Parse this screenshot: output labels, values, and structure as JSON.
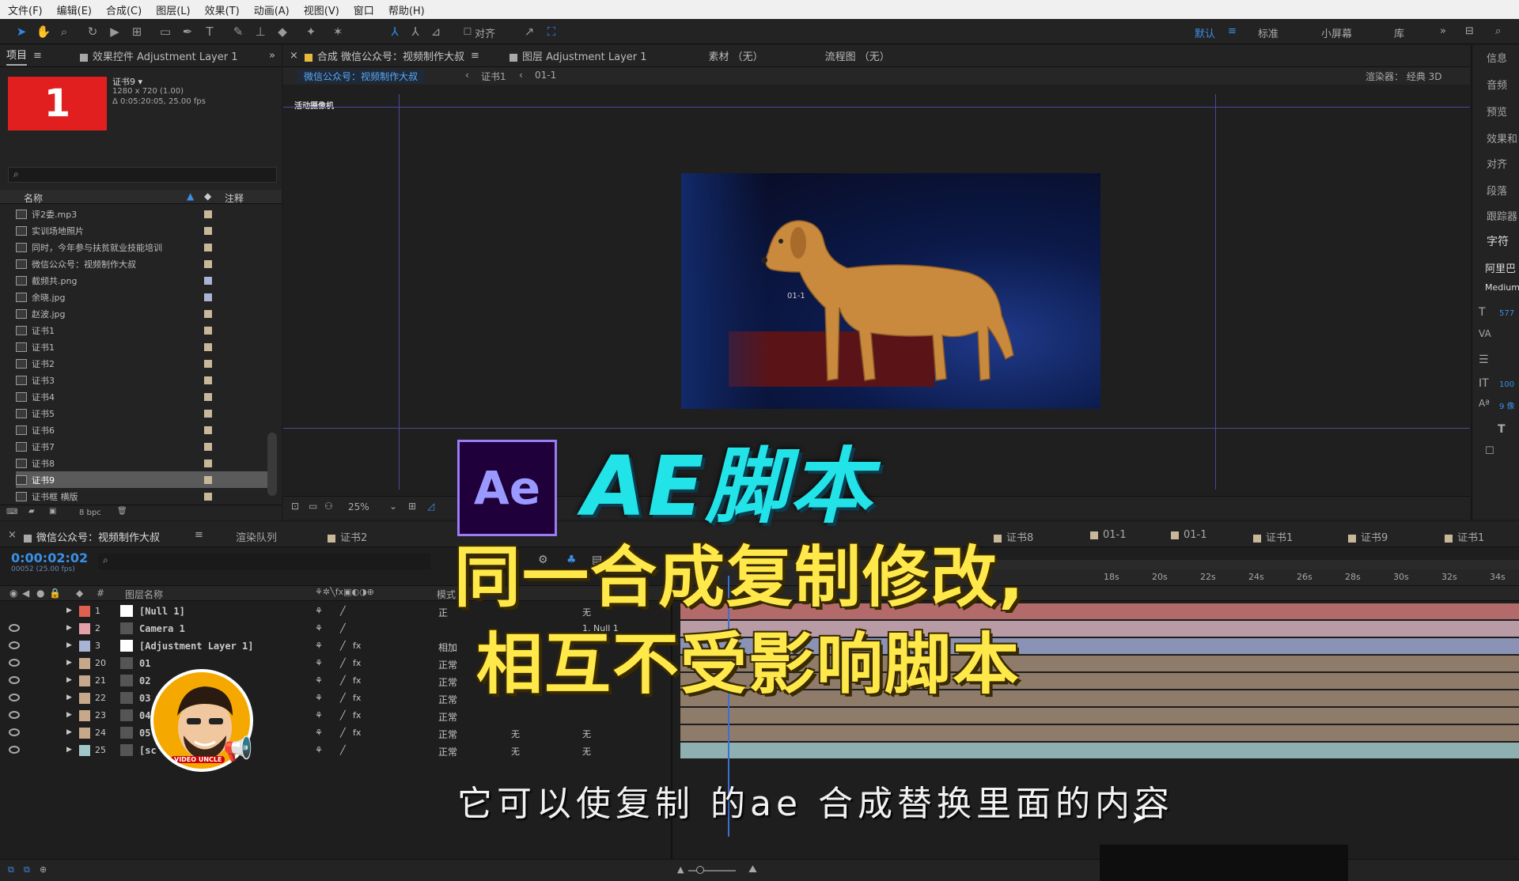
{
  "menu": [
    "文件(F)",
    "编辑(E)",
    "合成(C)",
    "图层(L)",
    "效果(T)",
    "动画(A)",
    "视图(V)",
    "窗口",
    "帮助(H)"
  ],
  "toolbar": {
    "align_label": "对齐",
    "workspaces": [
      "默认",
      "标准",
      "小屏幕",
      "库"
    ]
  },
  "project": {
    "tab": "项目",
    "effects_tab": "效果控件 Adjustment Layer 1",
    "thumb_number": "1",
    "comp_name": "证书9 ▾",
    "comp_size": "1280 x 720 (1.00)",
    "comp_duration": "Δ 0:05:20:05, 25.00 fps",
    "col_name": "名称",
    "col_comment": "注释",
    "items": [
      "评2委.mp3",
      "实训场地照片",
      "同时，今年参与扶贫就业技能培训",
      "微信公众号：视频制作大叔",
      "截频共.png",
      "余晓.jpg",
      "赵波.jpg",
      "证书1",
      "证书1",
      "证书2",
      "证书3",
      "证书4",
      "证书5",
      "证书6",
      "证书7",
      "证书8",
      "证书9",
      "证书框 横版"
    ],
    "bpc": "8 bpc"
  },
  "viewer": {
    "tabs": [
      "合成 微信公众号：视频制作大叔",
      "图层 Adjustment Layer 1",
      "素材 （无）",
      "流程图 （无）"
    ],
    "breadcrumb": [
      "微信公众号：视频制作大叔",
      "证书1",
      "01-1"
    ],
    "renderer": "渲染器： 经典 3D",
    "camera": "活动摄像机",
    "zoom": "25%",
    "layer_label": "01-1"
  },
  "right_panel": {
    "items": [
      "信息",
      "音频",
      "预览",
      "效果和",
      "对齐",
      "段落",
      "跟踪器",
      "字符",
      "阿里巴",
      "Medium"
    ],
    "font_size": "577",
    "leading": "100",
    "tracking": "9 像"
  },
  "timeline": {
    "tabs": [
      "微信公众号：视频制作大叔",
      "渲染队列",
      "证书2",
      "证书8",
      "01-1",
      "01-1",
      "证书1",
      "证书9",
      "证书1"
    ],
    "timecode": "0:00:02:02",
    "frames": "00052 (25.00 fps)",
    "col_layer": "图层名称",
    "col_mode": "模式",
    "ruler": [
      "18s",
      "20s",
      "22s",
      "24s",
      "26s",
      "28s",
      "30s",
      "32s",
      "34s"
    ],
    "layers": [
      {
        "num": "1",
        "name": "[Null 1]",
        "mode": "正",
        "color": "#e06050",
        "parent": "无",
        "track": "#b36a6a"
      },
      {
        "num": "2",
        "name": "Camera 1",
        "mode": "",
        "color": "#e4a0a8",
        "parent": "1. Null 1",
        "track": "#b99ba6"
      },
      {
        "num": "3",
        "name": "[Adjustment Layer 1]",
        "mode": "相加",
        "color": "#a9b3d3",
        "parent": "",
        "track": "#8a93b5"
      },
      {
        "num": "20",
        "name": "01",
        "mode": "正常",
        "color": "#c8a88a",
        "parent": "",
        "track": "#8f7b6a"
      },
      {
        "num": "21",
        "name": "02",
        "mode": "正常",
        "color": "#c8a88a",
        "parent": "",
        "track": "#8f7b6a"
      },
      {
        "num": "22",
        "name": "03",
        "mode": "正常",
        "color": "#c8a88a",
        "parent": "",
        "track": "#8f7b6a"
      },
      {
        "num": "23",
        "name": "04",
        "mode": "正常",
        "color": "#c8a88a",
        "parent": "",
        "track": "#8f7b6a"
      },
      {
        "num": "24",
        "name": "05",
        "mode": "正常",
        "color": "#c8a88a",
        "parent": "无",
        "track": "#8f7b6a"
      },
      {
        "num": "25",
        "name": "[sc",
        "mode": "正常",
        "color": "#a0c8c8",
        "parent": "无",
        "track": "#8fb0b0"
      }
    ],
    "matte": "无"
  },
  "overlay": {
    "ae_logo": "Ae",
    "title1": "AE脚本",
    "title2": "同一合成复制修改,",
    "title3": "相互不受影响脚本",
    "subtitle": "它可以使复制  的ae 合成替换里面的内容",
    "avatar_text": "VIDEO UNCLE"
  },
  "colors": {
    "accent": "#2d8ceb",
    "yellow": "#ffe94a",
    "cyan": "#22e3e8",
    "ae_purple": "#9999ff"
  }
}
